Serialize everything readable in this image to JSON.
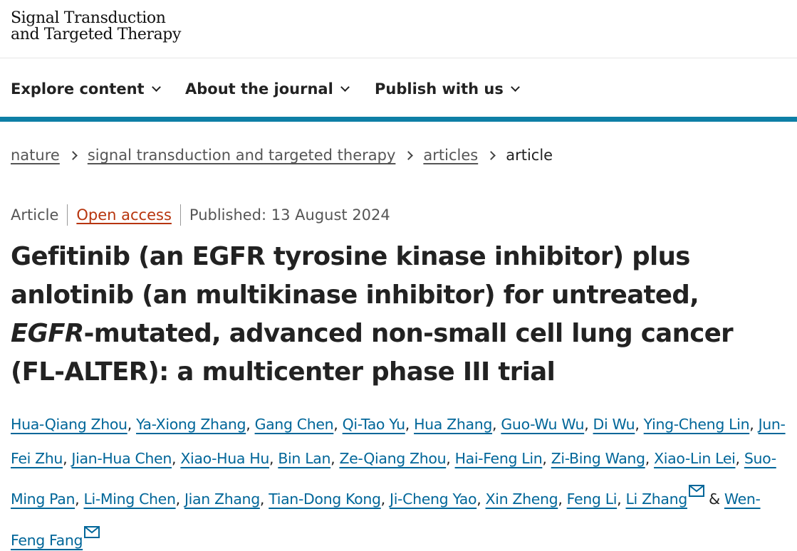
{
  "logo": {
    "line1": "Signal Transduction",
    "line2": "and Targeted Therapy"
  },
  "nav": [
    {
      "label": "Explore content"
    },
    {
      "label": "About the journal"
    },
    {
      "label": "Publish with us"
    }
  ],
  "breadcrumb": {
    "items": [
      "nature",
      "signal transduction and targeted therapy",
      "articles"
    ],
    "current": "article"
  },
  "meta": {
    "type": "Article",
    "access": "Open access",
    "published": "Published: 13 August 2024"
  },
  "title": {
    "part1": "Gefitinib (an EGFR tyrosine kinase inhibitor) plus anlotinib (an multikinase inhibitor) for untreated, ",
    "italic": "EGFR",
    "part2": "-mutated, advanced non-small cell lung cancer (FL-ALTER): a multicenter phase III trial"
  },
  "authors": [
    "Hua-Qiang Zhou",
    "Ya-Xiong Zhang",
    "Gang Chen",
    "Qi-Tao Yu",
    "Hua Zhang",
    "Guo-Wu Wu",
    "Di Wu",
    "Ying-Cheng Lin",
    "Jun-Fei Zhu",
    "Jian-Hua Chen",
    "Xiao-Hua Hu",
    "Bin Lan",
    "Ze-Qiang Zhou",
    "Hai-Feng Lin",
    "Zi-Bing Wang",
    "Xiao-Lin Lei",
    "Suo-Ming Pan",
    "Li-Ming Chen",
    "Jian Zhang",
    "Tian-Dong Kong",
    "Ji-Cheng Yao",
    "Xin Zheng",
    "Feng Li",
    "Li Zhang",
    "Wen-Feng Fang"
  ],
  "authors_last_sep": "&",
  "colors": {
    "accent": "#0e7fa6",
    "link": "#006699",
    "open_access": "#b7350e",
    "text": "#222222"
  },
  "icons": {
    "nav_chevron": "chevron-down-icon",
    "crumb_sep": "chevron-right-icon",
    "corresponding": "mail-icon"
  }
}
